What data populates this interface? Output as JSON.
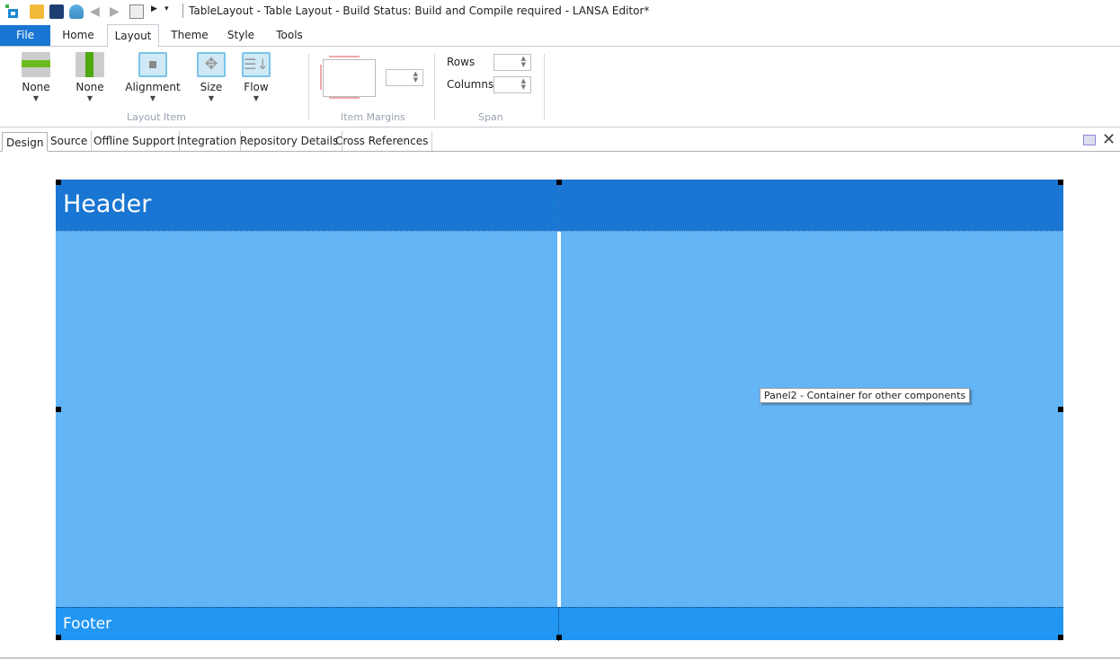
{
  "titlebar": {
    "title": "TableLayout - Table Layout -   Build Status: Build and Compile required - LANSA Editor*"
  },
  "ribbon_tabs": [
    "File",
    "Home",
    "Layout",
    "Theme",
    "Style",
    "Tools"
  ],
  "ribbon": {
    "layout_item": {
      "group_label": "Layout Item",
      "buttons": [
        "None",
        "None",
        "Alignment",
        "Size",
        "Flow"
      ]
    },
    "item_margins": {
      "group_label": "Item Margins",
      "value": ""
    },
    "span": {
      "group_label": "Span",
      "rows_label": "Rows",
      "columns_label": "Columns",
      "rows_value": "",
      "columns_value": ""
    }
  },
  "doc_tabs": [
    "Design",
    "Source",
    "Offline Support",
    "Integration",
    "Repository Details",
    "Cross References"
  ],
  "canvas": {
    "header": "Header",
    "footer": "Footer",
    "tooltip": "Panel2 - Container for other components"
  },
  "colors": {
    "accent": "#1976d2",
    "header": "#1976d2",
    "body": "#64b5f6",
    "footer": "#2196f3"
  }
}
